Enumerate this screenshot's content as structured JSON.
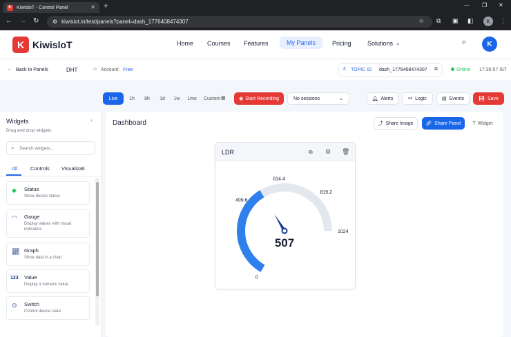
{
  "browser": {
    "tab_title": "KiwisloT - Control Panel",
    "url": "kiwisiot.in/test/panels?panel=dash_1776408474307",
    "profile_initial": "K"
  },
  "navbar": {
    "brand": "KiwisloT",
    "links": [
      "Home",
      "Courses",
      "Features",
      "My Panels",
      "Pricing",
      "Solutions"
    ],
    "avatar_initial": "K"
  },
  "subheader": {
    "back_label": "Back to Panels",
    "device": "DHT",
    "account_label": "Account:",
    "account_plan": "Free",
    "topic_label": "TOPIC ID",
    "topic_id": "dash_1776408474307",
    "status": "Online",
    "time": "17:35:57 IST"
  },
  "toolbar": {
    "ranges": [
      "Live",
      "1h",
      "8h",
      "1d",
      "1w",
      "1mo",
      "Custom"
    ],
    "record_label": "Start Recording",
    "sessions_label": "No sessions",
    "alerts": "Alerts",
    "logic": "Logic",
    "events": "Events",
    "save": "Save"
  },
  "sidebar": {
    "title": "Widgets",
    "subtitle": "Drag and drop widgets",
    "search_placeholder": "Search widgets...",
    "tabs": [
      "All",
      "Controls",
      "Visualizati"
    ],
    "widgets": [
      {
        "title": "Status",
        "desc": "Show device status"
      },
      {
        "title": "Gauge",
        "desc": "Display values with visual indicators"
      },
      {
        "title": "Graph",
        "desc": "Show data in a chart"
      },
      {
        "title": "Value",
        "desc": "Display a numeric value"
      },
      {
        "title": "Switch",
        "desc": "Control device state"
      }
    ]
  },
  "dashboard": {
    "title": "Dashboard",
    "share_image": "Share Image",
    "share_panel": "Share Panel",
    "widget_btn": "Widget"
  },
  "gauge": {
    "title": "LDR",
    "value": 507,
    "min": 0,
    "max": 1024,
    "ticks": [
      "0",
      "409.6",
      "614.4",
      "819.2",
      "1024"
    ],
    "value_text": "507",
    "fill_color": "#2f80ed",
    "track_color": "#e3e8ef"
  },
  "colors": {
    "accent": "#1a66e8",
    "danger": "#e53935",
    "online": "#22c55e"
  }
}
